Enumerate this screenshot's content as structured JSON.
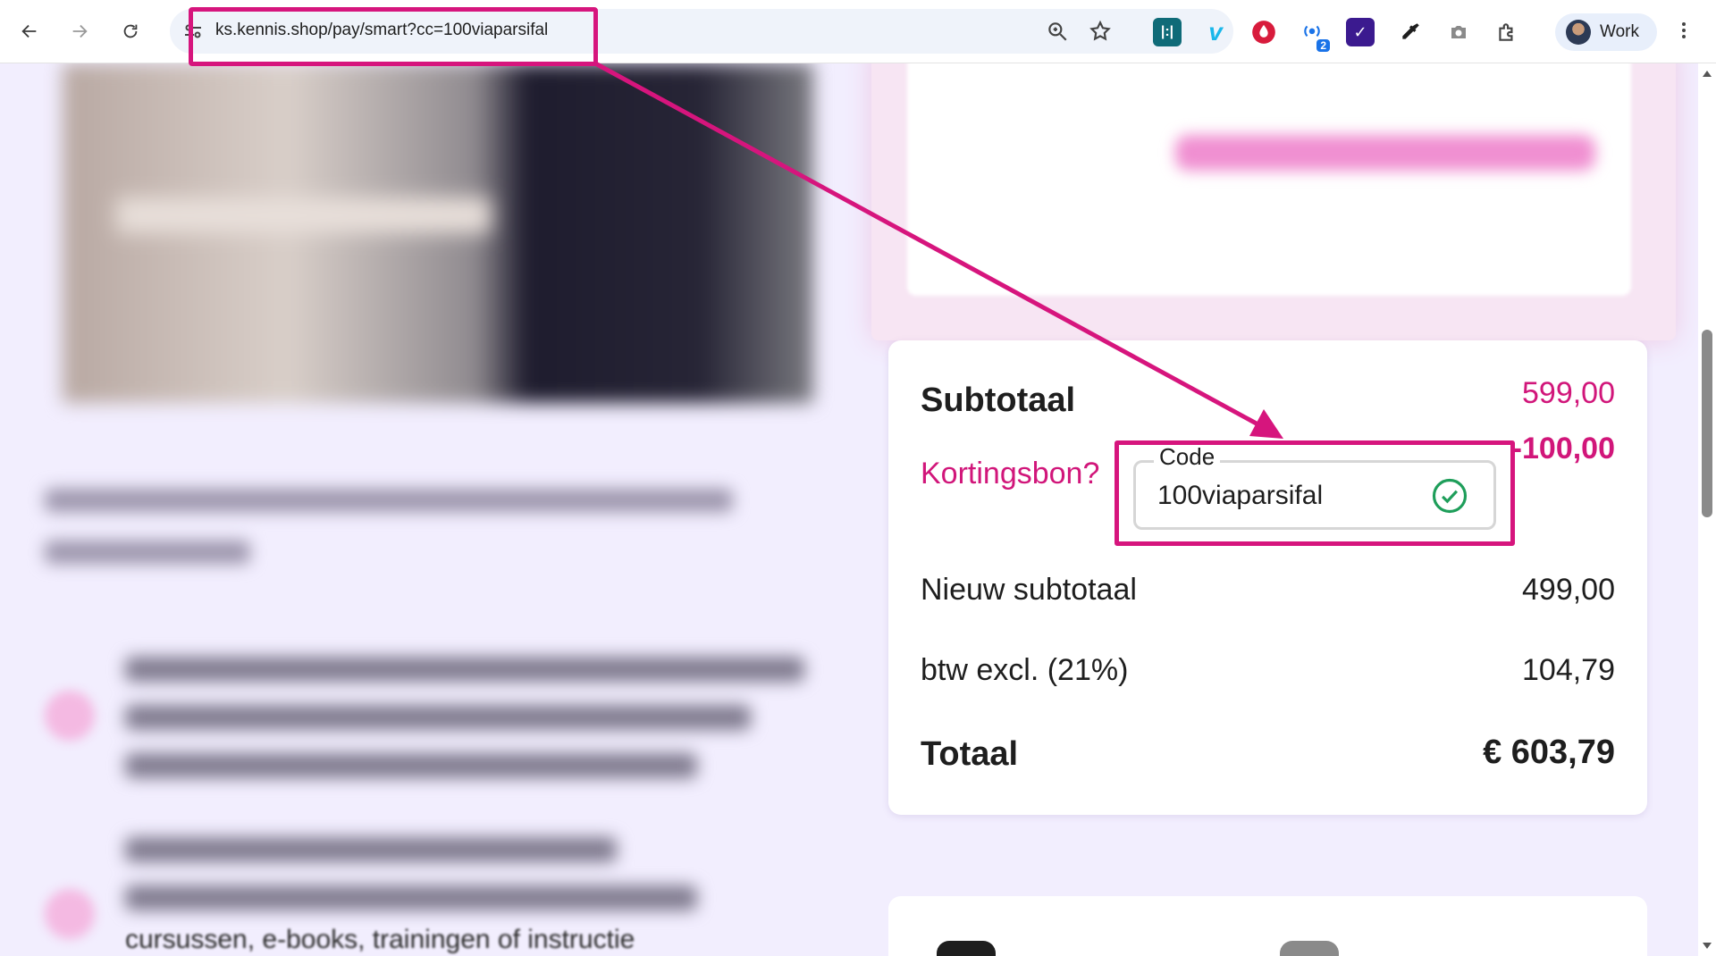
{
  "browser": {
    "url": "ks.kennis.shop/pay/smart?cc=100viaparsifal",
    "profile_label": "Work",
    "extension_badge": "2"
  },
  "order_summary": {
    "subtotal_label": "Subtotaal",
    "subtotal_value": "599,00",
    "discount_value": "-100,00",
    "coupon_label": "Kortingsbon?",
    "code_field_label": "Code",
    "code_value": "100viaparsifal",
    "new_subtotal_label": "Nieuw subtotaal",
    "new_subtotal_value": "499,00",
    "vat_label": "btw excl. (21%)",
    "vat_value": "104,79",
    "total_label": "Totaal",
    "total_value": "€ 603,79"
  },
  "left_column": {
    "partial_text": "cursussen, e-books, trainingen of instructie"
  },
  "colors": {
    "accent": "#d1167a",
    "annotation": "#d6157d",
    "page_background": "#f2eefe",
    "success": "#1e9e5a"
  }
}
